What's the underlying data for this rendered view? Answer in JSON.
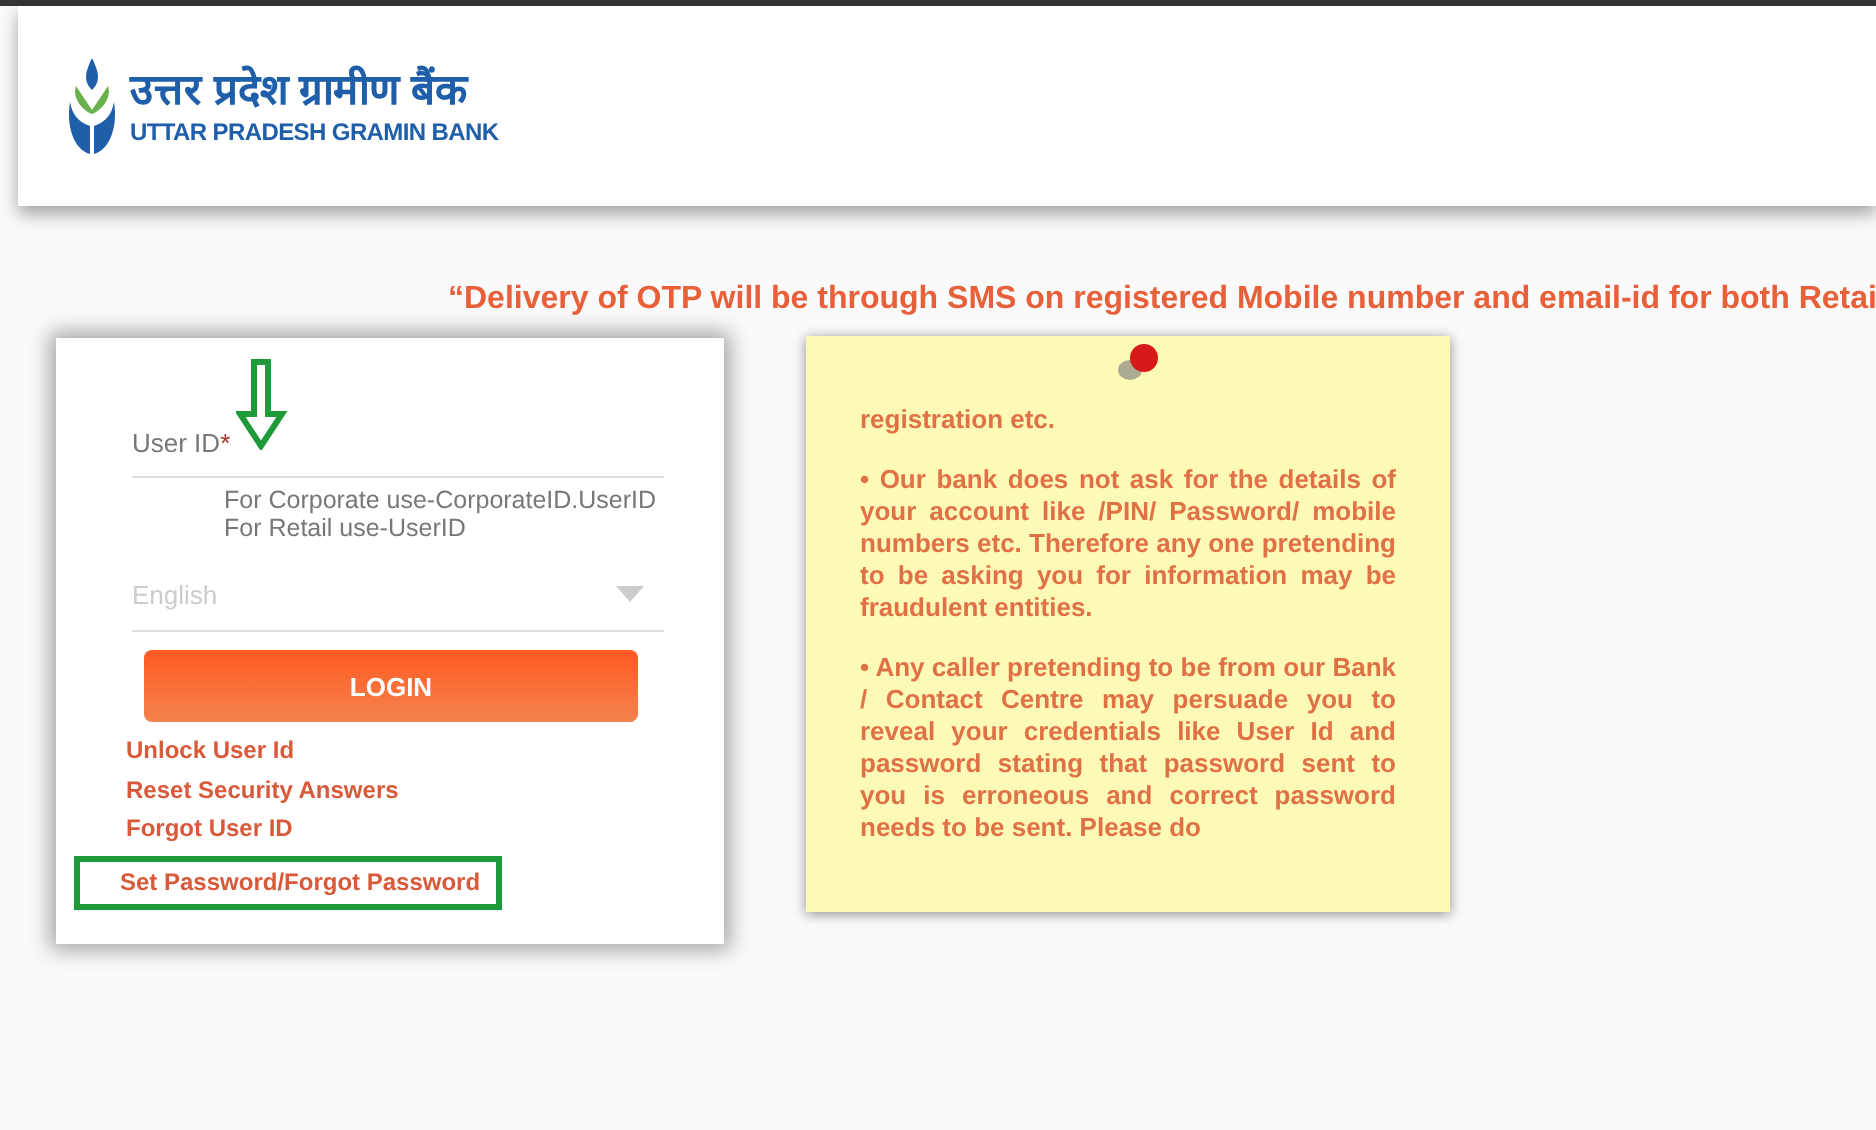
{
  "header": {
    "logo_hindi": "उत्तर प्रदेश ग्रामीण बैंक",
    "logo_english": "UTTAR PRADESH GRAMIN BANK"
  },
  "notice": "“Delivery of OTP will be through SMS on registered Mobile number and email-id for both Retai",
  "login": {
    "user_id": {
      "label": "User ID",
      "required_mark": "*"
    },
    "hints": [
      "For Corporate use-CorporateID.UserID",
      "For Retail use-UserID"
    ],
    "language": {
      "placeholder": "English"
    },
    "button": "LOGIN",
    "links": [
      {
        "label": "Unlock User Id",
        "highlighted": false
      },
      {
        "label": "Reset Security Answers",
        "highlighted": false
      },
      {
        "label": "Forgot User ID",
        "highlighted": false
      },
      {
        "label": "Set Password/Forgot Password",
        "highlighted": true
      }
    ]
  },
  "note": [
    "registration etc.",
    "• Our bank does not ask for the details of your account like /PIN/ Password/ mobile numbers etc. Therefore any one pretending to be asking you for information may be fraudulent entities.",
    "• Any caller pretending to be from our Bank / Contact Centre may persuade you to reveal your credentials like User Id and password stating that password sent to you is erroneous and correct password needs to be sent. Please do"
  ]
}
